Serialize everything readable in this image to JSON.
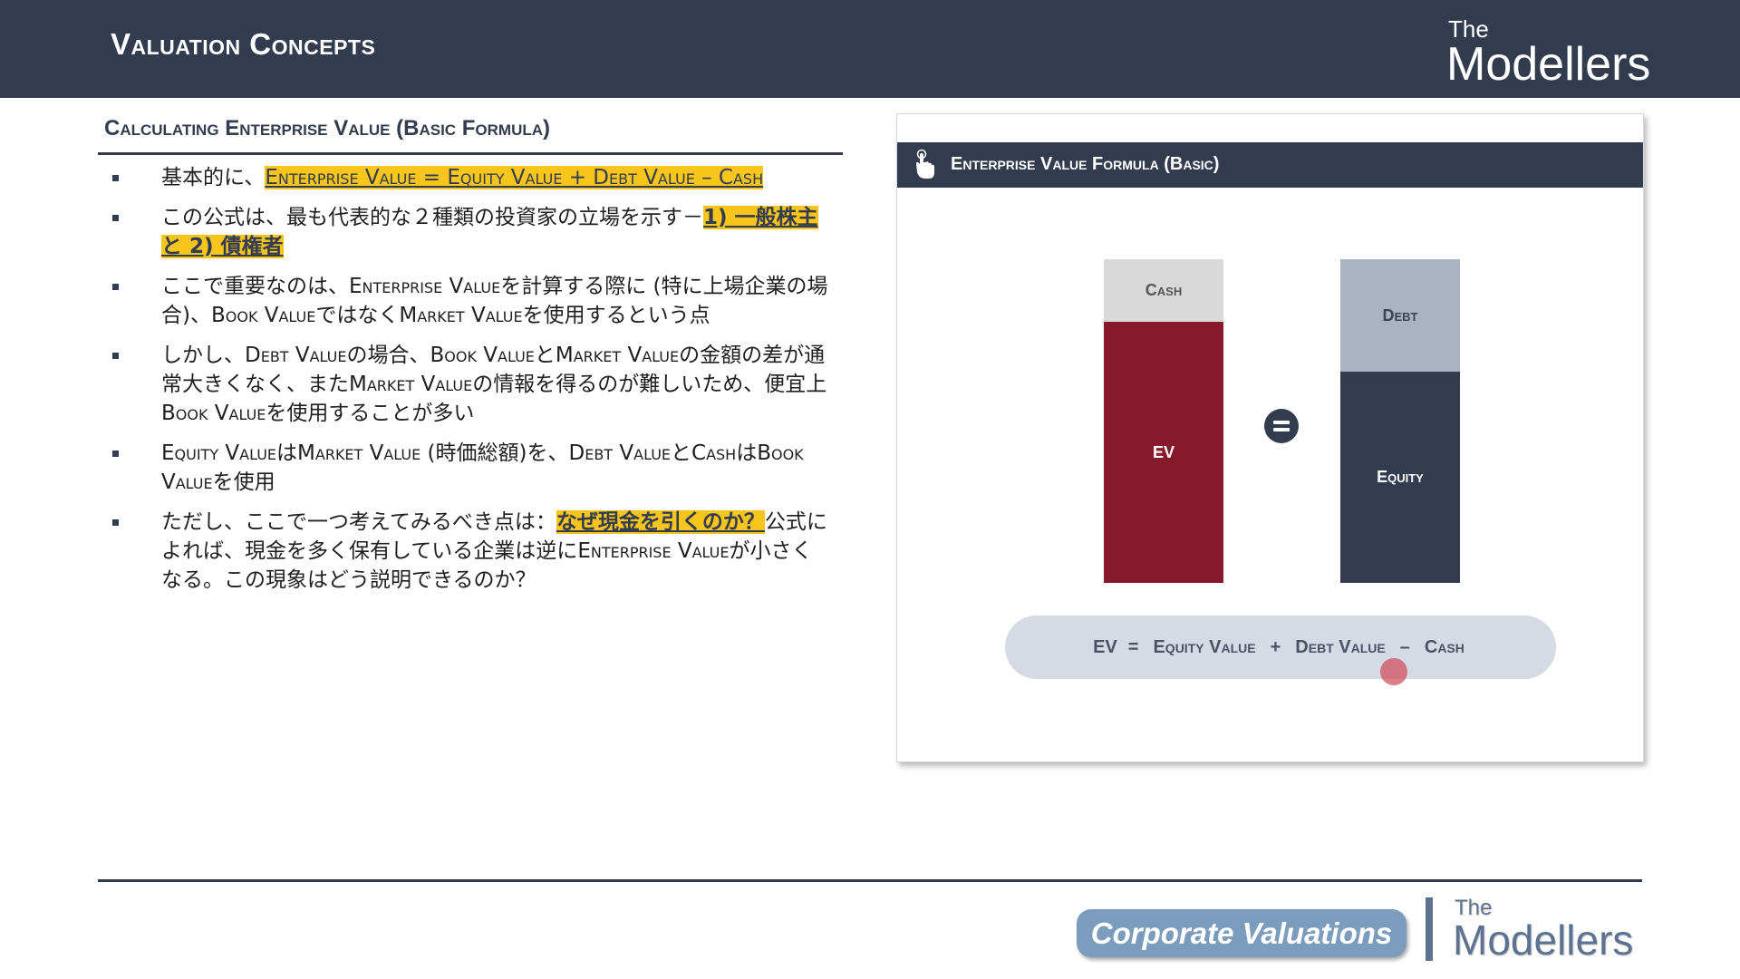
{
  "header": {
    "title": "Valuation Concepts",
    "logo_the": "The",
    "logo_name": "Modellers"
  },
  "section": {
    "heading": "Calculating Enterprise Value (Basic Formula)"
  },
  "bullets": {
    "b1": {
      "t1": "基本的に、",
      "formula": "Enterprise Value = Equity Value + Debt Value – Cash"
    },
    "b2": {
      "t1": "この公式は、最も代表的な２種類の投資家の立場を示す－",
      "hl": "1) 一般株主と 2) 債権者"
    },
    "b3": {
      "t1": "ここで重要なのは、",
      "sc1": "Enterprise Value",
      "t2": "を計算する際に (特に上場企業の場合)、",
      "sc2": "Book Value",
      "t3": "ではなく",
      "sc3": "Market Value",
      "t4": "を使用するという点"
    },
    "b4": {
      "t1": "しかし、",
      "sc1": "Debt Value",
      "t2": "の場合、",
      "sc2": "Book Value",
      "t3": "と",
      "sc3": "Market Value",
      "t4": "の金額の差が通常大きくなく、また",
      "sc4": "Market Value",
      "t5": "の情報を得るのが難しいため、便宜上 ",
      "sc5": "Book Value",
      "t6": "を使用することが多い"
    },
    "b5": {
      "sc1": "Equity Value",
      "t1": "は",
      "sc2": "Market Value",
      "t2": " (時価総額)を、",
      "sc3": "Debt Value",
      "t3": "と",
      "sc4": "Cash",
      "t4": "は",
      "sc5": "Book Value",
      "t5": "を使用"
    },
    "b6": {
      "t1": "ただし、ここで一つ考えてみるべき点は：",
      "hl": "なぜ現金を引くのか？",
      "t2": "公式によれば、現金を多く保有している企業は逆に",
      "sc1": "Enterprise Value",
      "t3": "が小さくなる。この現象はどう説明できるのか？"
    }
  },
  "panel": {
    "title": "Enterprise Value Formula (Basic)",
    "icon": "hand-pointer-icon",
    "left_stack": {
      "top_label": "Cash",
      "bottom_label": "EV"
    },
    "right_stack": {
      "top_label": "Debt",
      "bottom_label": "Equity"
    },
    "equals_icon": "equals-circle-icon",
    "formula": {
      "ev": "EV",
      "eq": "=",
      "equity": "Equity Value",
      "plus": "+",
      "debt": "Debt Value",
      "minus": "–",
      "cash": "Cash"
    }
  },
  "footer": {
    "badge": "Corporate Valuations",
    "logo_the": "The",
    "logo_name": "Modellers"
  },
  "colors": {
    "navy": "#333c4e",
    "maroon": "#851a2c",
    "highlight": "#f7c51b",
    "light_grey": "#d9d9d9",
    "steel": "#abb2c3",
    "pill": "#d5dae4",
    "badge": "#7b9cbd"
  }
}
